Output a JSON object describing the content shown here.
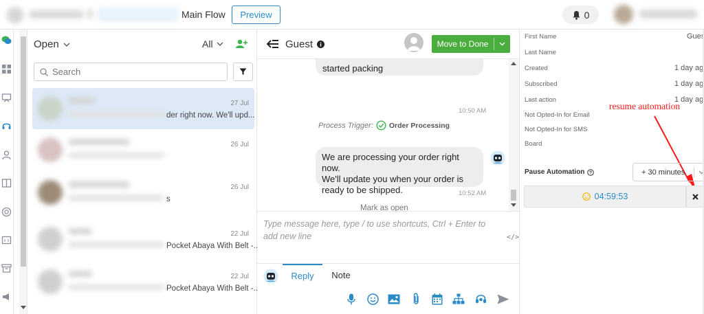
{
  "topbar": {
    "flow_title": "Main Flow",
    "preview_label": "Preview",
    "notification_count": "0"
  },
  "conversations": {
    "status_filter": "Open",
    "assignee_filter": "All",
    "search_placeholder": "Search",
    "items": [
      {
        "date": "27 Jul",
        "snippet": "der right now. We'll upd...",
        "active": true
      },
      {
        "date": "26 Jul",
        "snippet": "",
        "active": false
      },
      {
        "date": "26 Jul",
        "snippet": "s",
        "active": false
      },
      {
        "date": "22 Jul",
        "snippet": "Pocket Abaya With Belt -...",
        "active": false
      },
      {
        "date": "22 Jul",
        "snippet": "Pocket Abaya With Belt -...",
        "active": false
      }
    ]
  },
  "chat": {
    "contact_name": "Guest",
    "move_to_done_label": "Move to Done",
    "messages": {
      "m1_text": "started packing",
      "m1_time": "10:50 AM",
      "trigger_label": "Process Trigger:",
      "trigger_name": "Order Processing",
      "m2_line1": "We are processing your order right now.",
      "m2_line2": "We'll update you when your order is",
      "m2_line3": "ready to be shipped.",
      "m2_time": "10:52 AM",
      "mark_open": "Mark as open"
    },
    "composer_placeholder": "Type message here, type / to use shortcuts, Ctrl + Enter to add new line",
    "code_toggle": "</>",
    "tabs": {
      "reply": "Reply",
      "note": "Note"
    }
  },
  "details": {
    "attributes": [
      {
        "label": "First Name",
        "value": "Gues"
      },
      {
        "label": "Last Name",
        "value": ""
      },
      {
        "label": "Created",
        "value": "1 day ag"
      },
      {
        "label": "Subscribed",
        "value": "1 day ag"
      },
      {
        "label": "Last action",
        "value": "1 day ag"
      },
      {
        "label": "Not Opted-In for Email",
        "value": ""
      },
      {
        "label": "Not Opted-In for SMS",
        "value": ""
      },
      {
        "label": "Board",
        "value": ""
      }
    ],
    "pause_label": "Pause Automation",
    "pause_option": "+ 30 minutes",
    "timer": "04:59:53",
    "annotation": "resume automation"
  },
  "colors": {
    "accent": "#2a8bc9",
    "done_green": "#4aad3e",
    "annotation_red": "#ff1a1a",
    "active_row": "#dde9f7"
  }
}
